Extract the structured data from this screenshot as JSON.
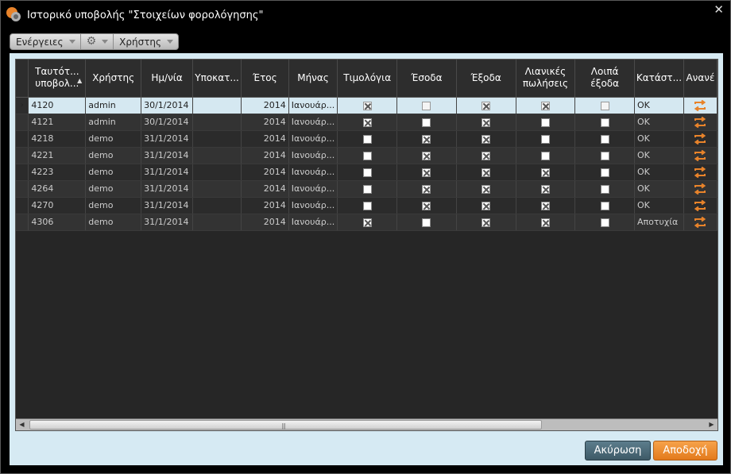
{
  "window": {
    "title": "Ιστορικό υποβολής \"Στοιχείων φορολόγησης\"",
    "close_glyph": "✕"
  },
  "toolbar": {
    "actions_label": "Ενέργειες",
    "settings_icon": "gear-icon",
    "user_label": "Χρήστης"
  },
  "grid": {
    "columns": [
      "Ταυτότ... υποβολ...",
      "Χρήστης",
      "Ημ/νία",
      "Υποκατ...",
      "Έτος",
      "Μήνας",
      "Τιμολόγια",
      "Έσοδα",
      "Έξοδα",
      "Λιανικές πωλήσεις",
      "Λοιπά έξοδα",
      "Κατάστ...",
      "Ανανέ"
    ],
    "col_id_line1": "Ταυτότ...",
    "col_id_line2": "υποβολ...",
    "col_retail_line1": "Λιανικές",
    "col_retail_line2": "πωλήσεις",
    "col_other_line1": "Λοιπά",
    "col_other_line2": "έξοδα",
    "rows": [
      {
        "id": "4120",
        "user": "admin",
        "date": "30/1/2014",
        "branch": "",
        "year": "2014",
        "month": "Ιανουάρ...",
        "invoices": true,
        "income": false,
        "expenses": true,
        "retail": true,
        "other": false,
        "status": "OK"
      },
      {
        "id": "4121",
        "user": "admin",
        "date": "30/1/2014",
        "branch": "",
        "year": "2014",
        "month": "Ιανουάρ...",
        "invoices": true,
        "income": false,
        "expenses": true,
        "retail": false,
        "other": false,
        "status": "OK"
      },
      {
        "id": "4218",
        "user": "demo",
        "date": "31/1/2014",
        "branch": "",
        "year": "2014",
        "month": "Ιανουάρ...",
        "invoices": false,
        "income": true,
        "expenses": true,
        "retail": false,
        "other": false,
        "status": "OK"
      },
      {
        "id": "4221",
        "user": "demo",
        "date": "31/1/2014",
        "branch": "",
        "year": "2014",
        "month": "Ιανουάρ...",
        "invoices": false,
        "income": true,
        "expenses": true,
        "retail": false,
        "other": false,
        "status": "OK"
      },
      {
        "id": "4223",
        "user": "demo",
        "date": "31/1/2014",
        "branch": "",
        "year": "2014",
        "month": "Ιανουάρ...",
        "invoices": false,
        "income": true,
        "expenses": true,
        "retail": true,
        "other": false,
        "status": "OK"
      },
      {
        "id": "4264",
        "user": "demo",
        "date": "31/1/2014",
        "branch": "",
        "year": "2014",
        "month": "Ιανουάρ...",
        "invoices": false,
        "income": true,
        "expenses": true,
        "retail": true,
        "other": false,
        "status": "OK"
      },
      {
        "id": "4270",
        "user": "demo",
        "date": "31/1/2014",
        "branch": "",
        "year": "2014",
        "month": "Ιανουάρ...",
        "invoices": false,
        "income": true,
        "expenses": true,
        "retail": true,
        "other": false,
        "status": "OK"
      },
      {
        "id": "4306",
        "user": "demo",
        "date": "31/1/2014",
        "branch": "",
        "year": "2014",
        "month": "Ιανουάρ...",
        "invoices": true,
        "income": false,
        "expenses": true,
        "retail": true,
        "other": false,
        "status": "Αποτυχία"
      }
    ]
  },
  "buttons": {
    "cancel": "Ακύρωση",
    "ok": "Αποδοχή"
  },
  "colors": {
    "accent_orange": "#e8832a",
    "cancel_blue": "#4a6a78",
    "selection": "#d5e8f1"
  }
}
